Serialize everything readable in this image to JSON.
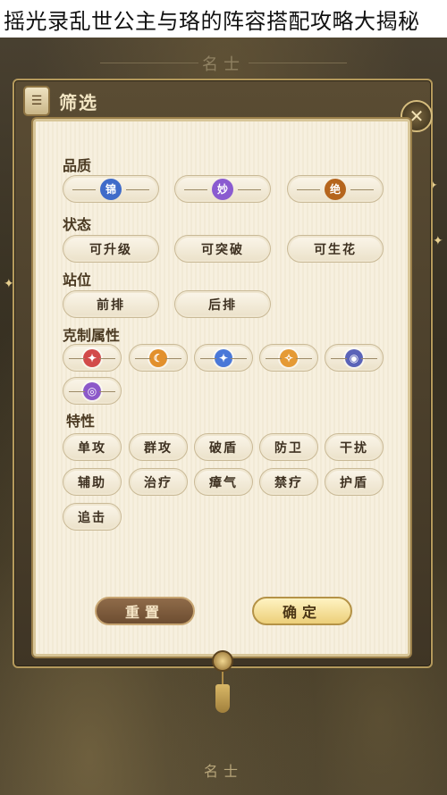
{
  "banner": {
    "title": "摇光录乱世公主与珞的阵容搭配攻略大揭秘"
  },
  "background": {
    "top_label": "名士",
    "bottom_label": "名士"
  },
  "header": {
    "icon_glyph": "☰",
    "title": "筛选",
    "close_icon": "close-icon"
  },
  "sections": {
    "quality": {
      "title": "品质",
      "options": [
        {
          "glyph": "锦",
          "color": "#3f6bc9"
        },
        {
          "glyph": "妙",
          "color": "#8a5bd0"
        },
        {
          "glyph": "绝",
          "color": "#b5651d"
        }
      ]
    },
    "status": {
      "title": "状态",
      "options": [
        "可升级",
        "可突破",
        "可生花"
      ]
    },
    "position": {
      "title": "站位",
      "options": [
        "前排",
        "后排"
      ]
    },
    "counter": {
      "title": "克制属性",
      "options": [
        {
          "icon": "fire-element-icon",
          "color": "#d24a4a",
          "glyph": "✦"
        },
        {
          "icon": "moon-element-icon",
          "color": "#e2902c",
          "glyph": "☾"
        },
        {
          "icon": "star-element-icon",
          "color": "#4a78d8",
          "glyph": "✦"
        },
        {
          "icon": "sun-element-icon",
          "color": "#e59a35",
          "glyph": "✧"
        },
        {
          "icon": "eye-element-icon",
          "color": "#5a63b8",
          "glyph": "◉"
        },
        {
          "icon": "spiral-element-icon",
          "color": "#8c58c9",
          "glyph": "◎"
        }
      ]
    },
    "traits": {
      "title": "特性",
      "options": [
        "单攻",
        "群攻",
        "破盾",
        "防卫",
        "干扰",
        "辅助",
        "治疗",
        "瘴气",
        "禁疗",
        "护盾",
        "追击"
      ]
    }
  },
  "actions": {
    "reset": "重置",
    "confirm": "确定"
  }
}
